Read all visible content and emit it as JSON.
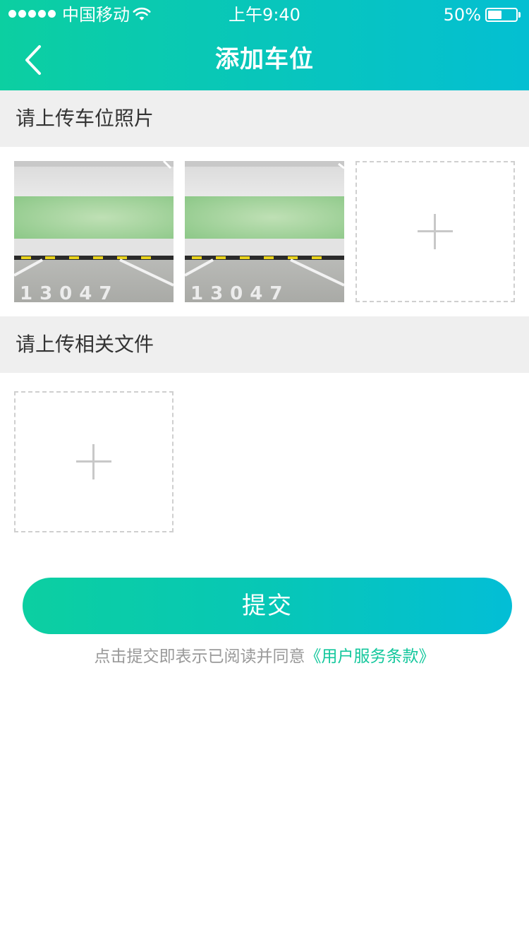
{
  "status_bar": {
    "carrier": "中国移动",
    "time": "上午9:40",
    "battery": "50%",
    "battery_level": 0.5
  },
  "nav": {
    "title": "添加车位",
    "back_icon": "chevron-left-icon"
  },
  "sections": {
    "photos_title": "请上传车位照片",
    "files_title": "请上传相关文件"
  },
  "photos": [
    {
      "number": "13047"
    },
    {
      "number": "13047"
    }
  ],
  "actions": {
    "submit_label": "提交"
  },
  "terms": {
    "prefix": "点击提交即表示已阅读并同意",
    "link": "《用户服务条款》"
  },
  "colors": {
    "brand_start": "#0ccfa1",
    "brand_end": "#04bfd2",
    "link": "#13c79c",
    "section_bg": "#efefef"
  }
}
